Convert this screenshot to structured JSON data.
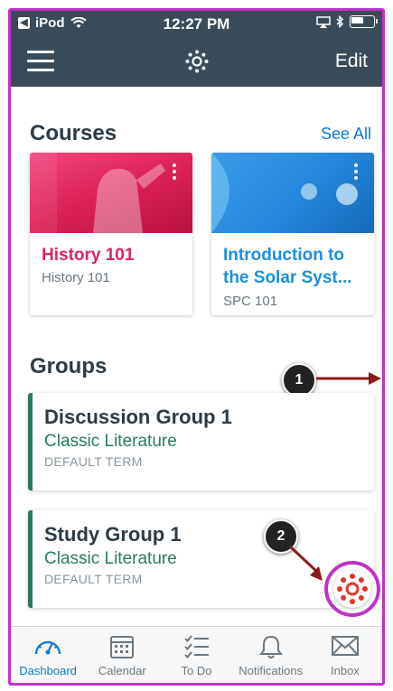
{
  "status_bar": {
    "carrier": "iPod",
    "time": "12:27 PM"
  },
  "nav": {
    "edit_label": "Edit",
    "logo_icon": "canvas-logo-icon"
  },
  "courses": {
    "title": "Courses",
    "see_all_label": "See All",
    "cards": [
      {
        "name": "History 101",
        "code": "History 101",
        "color": "#e0245e"
      },
      {
        "name": "Introduction to the Solar Syst...",
        "code": "SPC 101",
        "color": "#1b8fe0"
      }
    ]
  },
  "groups": {
    "title": "Groups",
    "cards": [
      {
        "name": "Discussion Group 1",
        "course": "Classic Literature",
        "term": "DEFAULT TERM"
      },
      {
        "name": "Study Group 1",
        "course": "Classic Literature",
        "term": "DEFAULT TERM"
      }
    ]
  },
  "callouts": [
    "1",
    "2"
  ],
  "tabs": [
    {
      "label": "Dashboard",
      "icon": "dashboard-icon",
      "active": true
    },
    {
      "label": "Calendar",
      "icon": "calendar-icon",
      "active": false
    },
    {
      "label": "To Do",
      "icon": "todo-icon",
      "active": false
    },
    {
      "label": "Notifications",
      "icon": "bell-icon",
      "active": false
    },
    {
      "label": "Inbox",
      "icon": "envelope-icon",
      "active": false
    }
  ],
  "colors": {
    "nav_bg": "#394b58",
    "accent": "#0b7ad6",
    "highlight": "#c032c7",
    "group_accent": "#2a7a60",
    "canvas_red": "#e4372b"
  }
}
